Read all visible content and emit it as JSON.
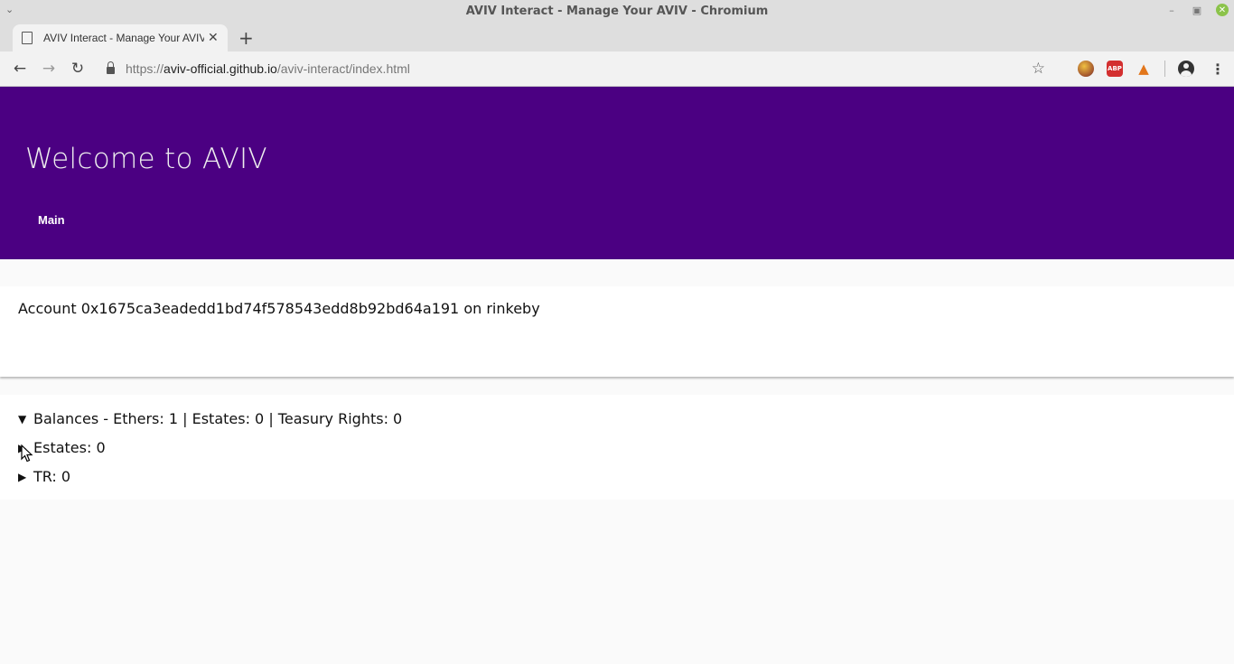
{
  "window": {
    "title": "AVIV Interact - Manage Your AVIV - Chromium"
  },
  "tab": {
    "title": "AVIV Interact - Manage Your AVIV"
  },
  "toolbar": {
    "url_scheme": "https://",
    "url_host": "aviv-official.github.io",
    "url_path": "/aviv-interact/index.html",
    "ext_abp_label": "ABP"
  },
  "hero": {
    "heading": "Welcome to AVIV",
    "nav_main": "Main"
  },
  "account": {
    "line": "Account 0x1675ca3eadedd1bd74f578543edd8b92bd64a191 on rinkeby"
  },
  "balances": {
    "summary": "Balances - Ethers: 1 | Estates: 0 | Teasury Rights: 0",
    "estates": "Estates: 0",
    "tr": "TR: 0"
  },
  "colors": {
    "hero_bg": "#4b0082"
  }
}
